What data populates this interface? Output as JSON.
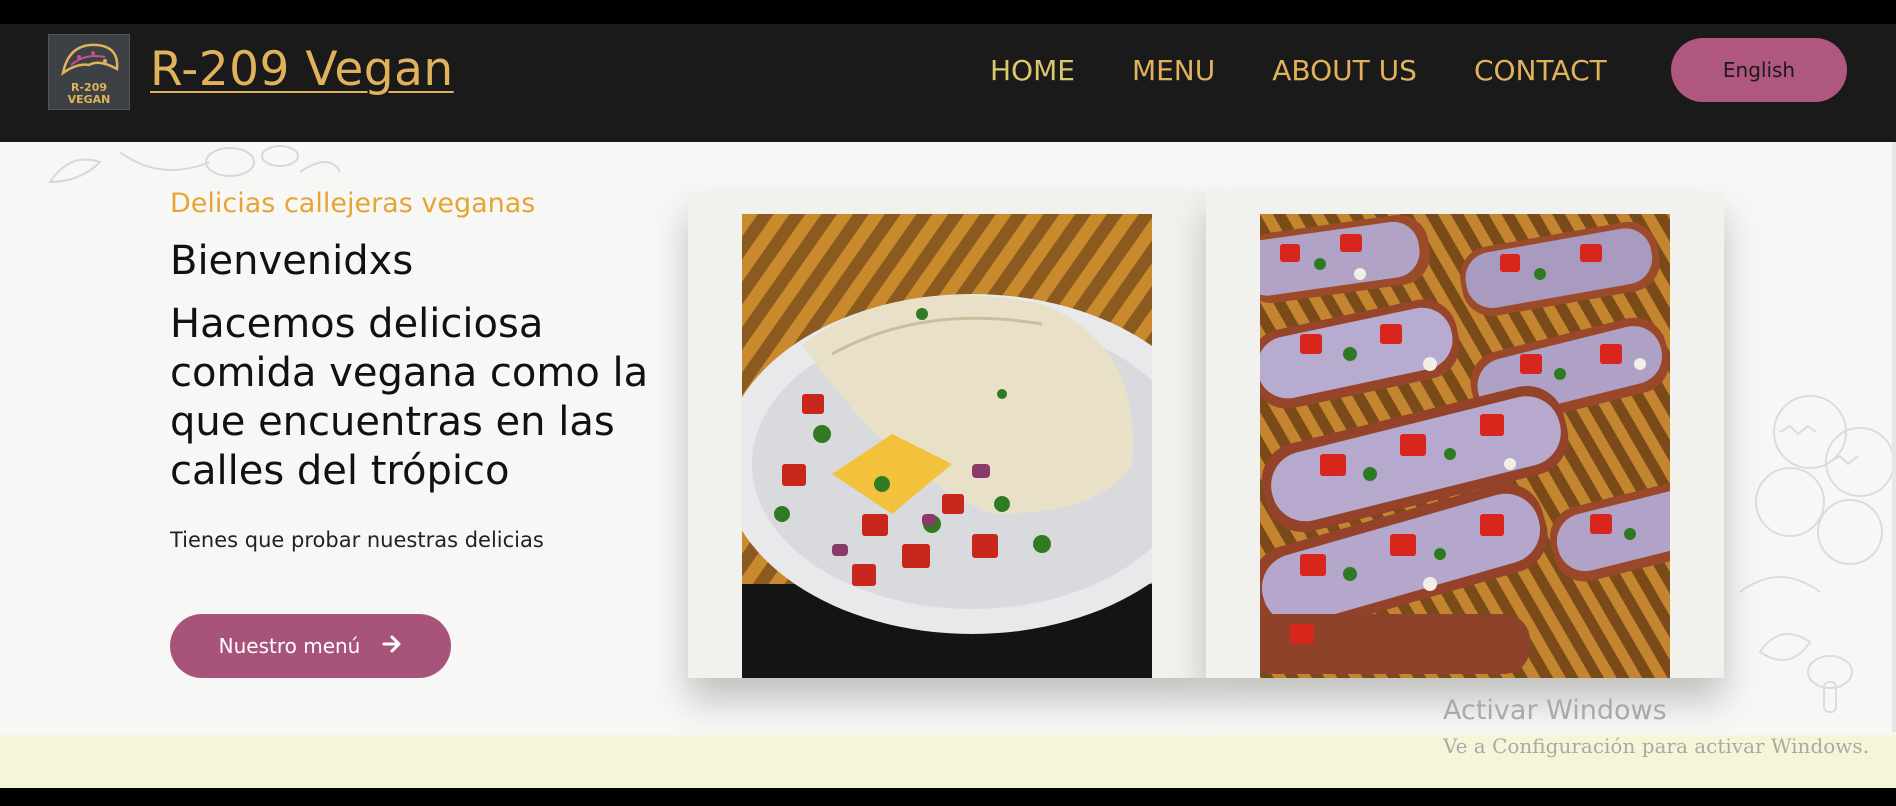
{
  "header": {
    "logo_text_line1": "R-209",
    "logo_text_line2": "VEGAN",
    "brand": "R-209 Vegan",
    "nav": [
      "HOME",
      "MENU",
      "ABOUT US",
      "CONTACT"
    ],
    "language_button": "English"
  },
  "hero": {
    "tagline": "Delicias callejeras veganas",
    "welcome": "Bienvenidxs",
    "headline": "Hacemos deliciosa comida vegana como la que encuentras en las calles del trópico",
    "subtext": "Tienes que probar nuestras delicias",
    "cta_label": "Nuestro menú",
    "cta_icon": "arrow-right-icon"
  },
  "images": [
    {
      "name": "taco-plate-photo"
    },
    {
      "name": "bruschetta-tray-photo"
    }
  ],
  "os_overlay": {
    "title": "Activar Windows",
    "subtitle": "Ve a Configuración para activar Windows."
  },
  "colors": {
    "accent_gold": "#e0b35a",
    "button_pink": "#b0577f",
    "navbar": "#1a1a1a",
    "hero_bg": "#f7f7f6"
  }
}
